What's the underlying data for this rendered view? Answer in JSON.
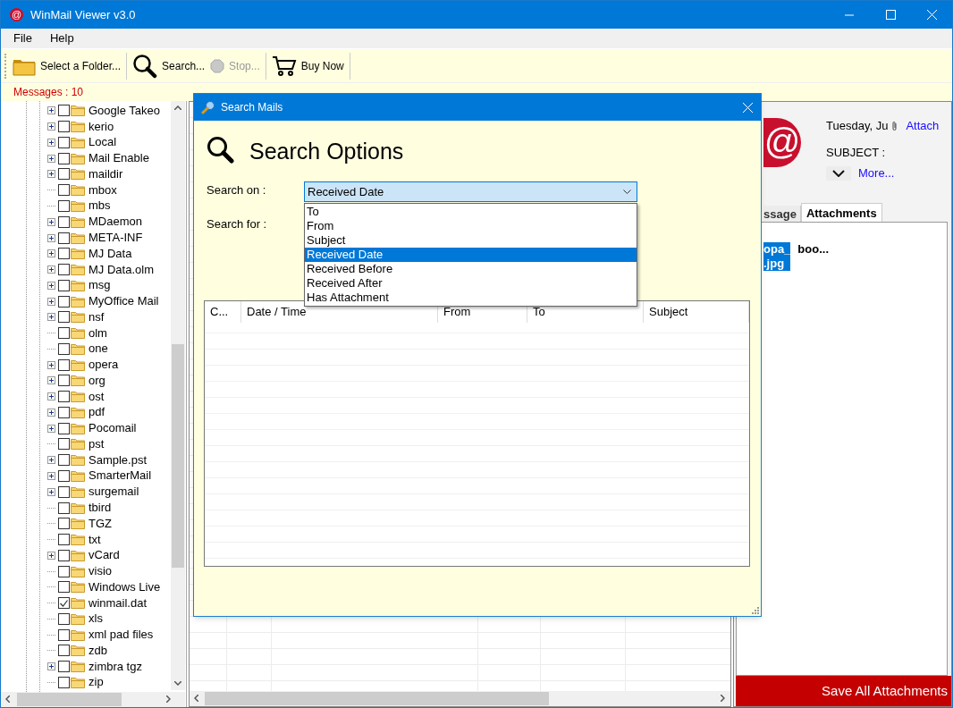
{
  "window": {
    "app_glyph": "@",
    "title": "WinMail Viewer v3.0"
  },
  "menu": [
    "File",
    "Help"
  ],
  "toolbar": [
    {
      "label": "Select a Folder...",
      "kind": "folder",
      "disabled": false
    },
    {
      "label": "Search...",
      "kind": "search",
      "disabled": false
    },
    {
      "label": "Stop...",
      "kind": "stop",
      "disabled": true
    },
    {
      "label": "Buy Now",
      "kind": "cart",
      "disabled": false
    }
  ],
  "messages_count": "Messages : 10",
  "folder_tree": [
    {
      "label": "Google Takeo",
      "expandable": true,
      "checked": false
    },
    {
      "label": "kerio",
      "expandable": true,
      "checked": false
    },
    {
      "label": "Local",
      "expandable": true,
      "checked": false
    },
    {
      "label": "Mail Enable",
      "expandable": true,
      "checked": false
    },
    {
      "label": "maildir",
      "expandable": true,
      "checked": false
    },
    {
      "label": "mbox",
      "expandable": false,
      "checked": false
    },
    {
      "label": "mbs",
      "expandable": false,
      "checked": false
    },
    {
      "label": "MDaemon",
      "expandable": true,
      "checked": false
    },
    {
      "label": "META-INF",
      "expandable": true,
      "checked": false
    },
    {
      "label": "MJ Data",
      "expandable": true,
      "checked": false
    },
    {
      "label": "MJ Data.olm",
      "expandable": true,
      "checked": false
    },
    {
      "label": "msg",
      "expandable": true,
      "checked": false
    },
    {
      "label": "MyOffice Mail",
      "expandable": true,
      "checked": false
    },
    {
      "label": "nsf",
      "expandable": true,
      "checked": false
    },
    {
      "label": "olm",
      "expandable": false,
      "checked": false
    },
    {
      "label": "one",
      "expandable": false,
      "checked": false
    },
    {
      "label": "opera",
      "expandable": true,
      "checked": false
    },
    {
      "label": "org",
      "expandable": true,
      "checked": false
    },
    {
      "label": "ost",
      "expandable": true,
      "checked": false
    },
    {
      "label": "pdf",
      "expandable": true,
      "checked": false
    },
    {
      "label": "Pocomail",
      "expandable": true,
      "checked": false
    },
    {
      "label": "pst",
      "expandable": false,
      "checked": false
    },
    {
      "label": "Sample.pst",
      "expandable": true,
      "checked": false
    },
    {
      "label": "SmarterMail",
      "expandable": true,
      "checked": false
    },
    {
      "label": "surgemail",
      "expandable": true,
      "checked": false
    },
    {
      "label": "tbird",
      "expandable": false,
      "checked": false
    },
    {
      "label": "TGZ",
      "expandable": false,
      "checked": false
    },
    {
      "label": "txt",
      "expandable": false,
      "checked": false
    },
    {
      "label": "vCard",
      "expandable": true,
      "checked": false
    },
    {
      "label": "visio",
      "expandable": false,
      "checked": false
    },
    {
      "label": "Windows Live",
      "expandable": false,
      "checked": false
    },
    {
      "label": "winmail.dat",
      "expandable": false,
      "checked": true
    },
    {
      "label": "xls",
      "expandable": false,
      "checked": false
    },
    {
      "label": "xml pad files",
      "expandable": false,
      "checked": false
    },
    {
      "label": "zdb",
      "expandable": false,
      "checked": false
    },
    {
      "label": "zimbra tgz",
      "expandable": true,
      "checked": false
    },
    {
      "label": "zip",
      "expandable": false,
      "checked": false
    }
  ],
  "preview": {
    "logo_glyph": "@",
    "date": "Tuesday, Ju",
    "attach_link": "Attach",
    "subject_label": "SUBJECT :",
    "more_link": "More...",
    "tabs": [
      {
        "label": "ssage",
        "selected": false
      },
      {
        "label": "Attachments",
        "selected": true
      }
    ],
    "attachments": [
      {
        "lines": [
          "opa_",
          ".jpg"
        ],
        "selected": true
      },
      {
        "lines": [
          "boo..."
        ],
        "selected": false
      }
    ],
    "save_button": "Save All  Attachments"
  },
  "dialog": {
    "title": "Search Mails",
    "heading": "Search Options",
    "search_on_label": "Search on :",
    "search_for_label": "Search for :",
    "combo": {
      "value": "Received Date",
      "expanded": true
    },
    "options": [
      {
        "label": "To",
        "selected": false
      },
      {
        "label": "From",
        "selected": false
      },
      {
        "label": "Subject",
        "selected": false
      },
      {
        "label": "Received Date",
        "selected": true
      },
      {
        "label": "Received Before",
        "selected": false
      },
      {
        "label": "Received After",
        "selected": false
      },
      {
        "label": "Has Attachment",
        "selected": false
      }
    ],
    "results_columns": [
      "C...",
      "Date / Time",
      "From",
      "To",
      "Subject"
    ]
  }
}
